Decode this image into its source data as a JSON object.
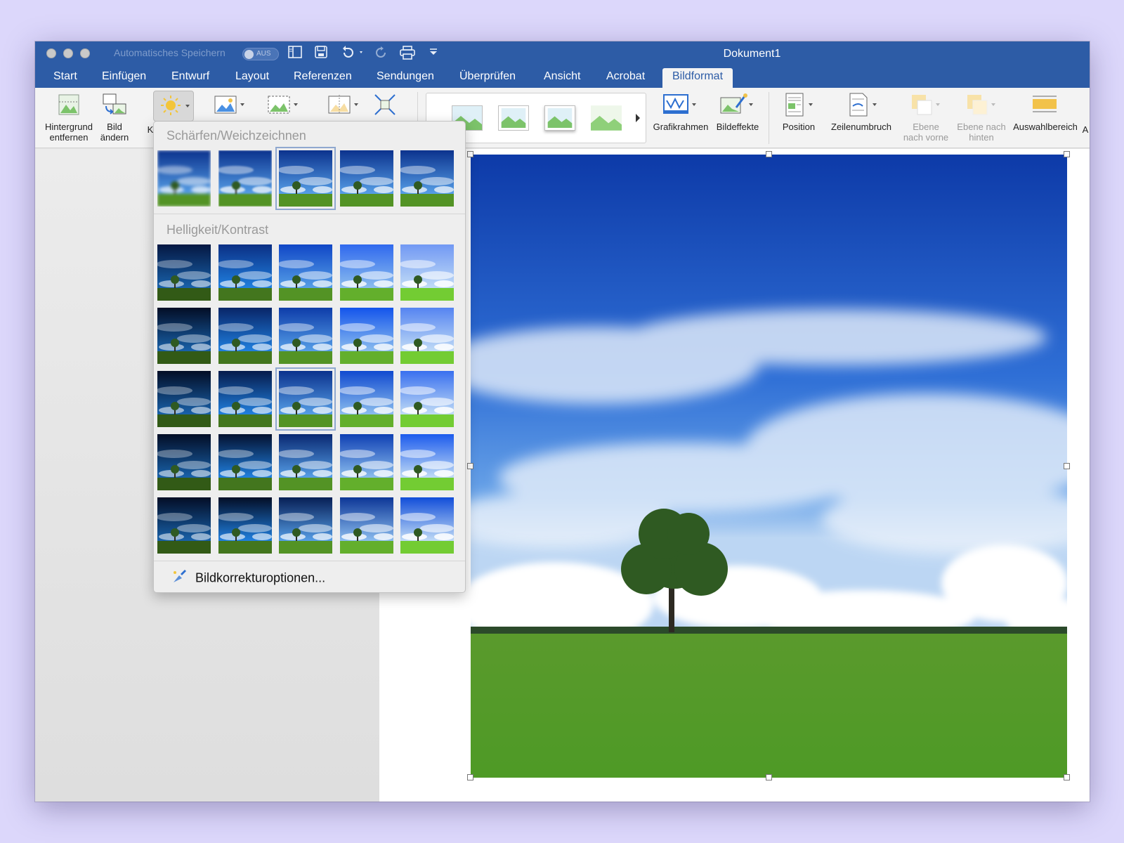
{
  "titlebar": {
    "autosave_label": "Automatisches Speichern",
    "autosave_state": "AUS",
    "document_title": "Dokument1"
  },
  "tabs": [
    {
      "label": "Start"
    },
    {
      "label": "Einfügen"
    },
    {
      "label": "Entwurf"
    },
    {
      "label": "Layout"
    },
    {
      "label": "Referenzen"
    },
    {
      "label": "Sendungen"
    },
    {
      "label": "Überprüfen"
    },
    {
      "label": "Ansicht"
    },
    {
      "label": "Acrobat"
    },
    {
      "label": "Bildformat",
      "active": true
    }
  ],
  "ribbon": {
    "remove_background": {
      "line1": "Hintergrund",
      "line2": "entfernen"
    },
    "change_picture": {
      "line1": "Bild",
      "line2": "ändern"
    },
    "corrections_partial": "K",
    "picture_frame": "Grafikrahmen",
    "picture_effects": "Bildeffekte",
    "position": "Position",
    "wrap_text": "Zeilenumbruch",
    "bring_forward": {
      "line1": "Ebene",
      "line2": "nach vorne"
    },
    "send_backward": {
      "line1": "Ebene nach",
      "line2": "hinten"
    },
    "selection_pane": "Auswahlbereich",
    "overflow_partial": "A"
  },
  "dropdown": {
    "section_sharpen": "Schärfen/Weichzeichnen",
    "section_brightness": "Helligkeit/Kontrast",
    "options_link": "Bildkorrekturoptionen...",
    "sharpen_selected_index": 2,
    "brightness_selected": {
      "row": 2,
      "col": 2
    }
  },
  "colors": {
    "titlebar": "#2d5ca6",
    "ribbon": "#f3f3f3",
    "background": "#dcd7fb",
    "selection_outline": "#8fa8cf"
  }
}
